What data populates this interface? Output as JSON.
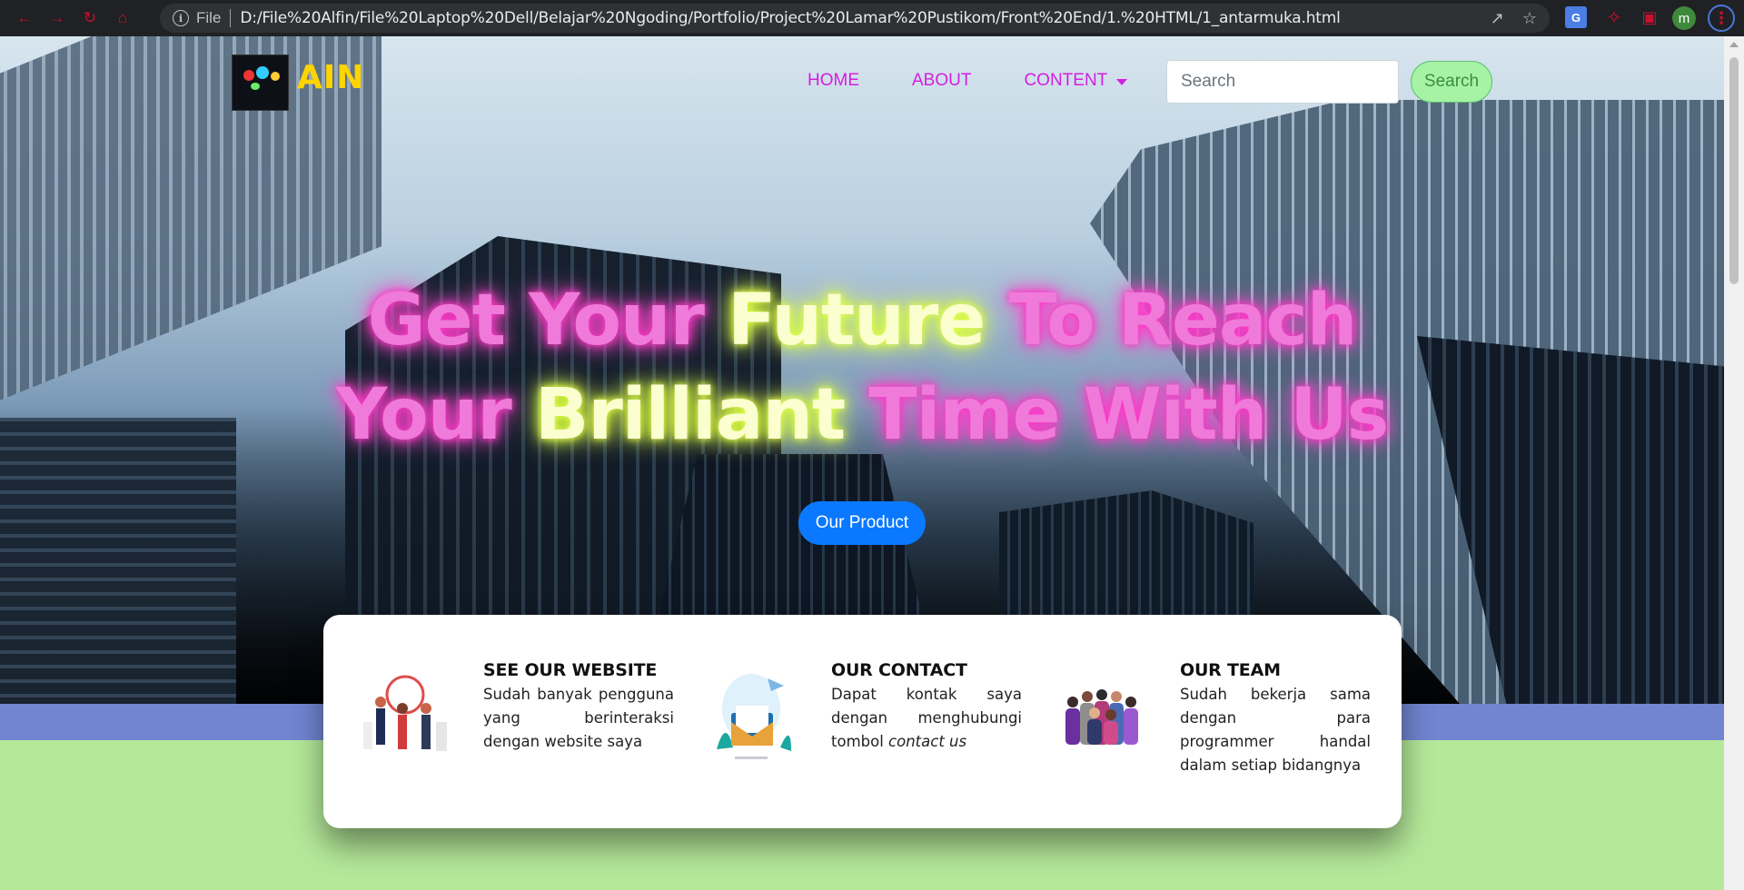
{
  "browser": {
    "file_label": "File",
    "url": "D:/File%20Alfin/File%20Laptop%20Dell/Belajar%20Ngoding/Portfolio/Project%20Lamar%20Pustikom/Front%20End/1.%20HTML/1_antarmuka.html",
    "profile_initial": "m",
    "accent_color": "#c8102e"
  },
  "nav": {
    "logo_text": "AIN",
    "items": [
      {
        "label": "HOME"
      },
      {
        "label": "ABOUT"
      },
      {
        "label": "CONTENT"
      }
    ],
    "search_placeholder": "Search",
    "search_button": "Search"
  },
  "hero": {
    "line1": [
      "Get Your",
      "Future",
      "To Reach"
    ],
    "line2": [
      "Your",
      "Brilliant",
      "Time With Us"
    ],
    "cta_label": "Our Product"
  },
  "features": [
    {
      "title": "SEE OUR WEBSITE",
      "desc": "Sudah banyak pengguna yang berinteraksi dengan website saya",
      "emphasis": ""
    },
    {
      "title": "OUR CONTACT",
      "desc": "Dapat kontak saya dengan menghubungi tombol",
      "emphasis": "contact us"
    },
    {
      "title": "OUR TEAM",
      "desc": "Sudah bekerja sama dengan para programmer handal dalam setiap bidangnya",
      "emphasis": ""
    }
  ],
  "colors": {
    "menu": "#d21fe0",
    "logo": "#ffd400",
    "cta": "#0a78ff",
    "band_blue": "#7285d1",
    "band_green": "#b5e99a"
  }
}
